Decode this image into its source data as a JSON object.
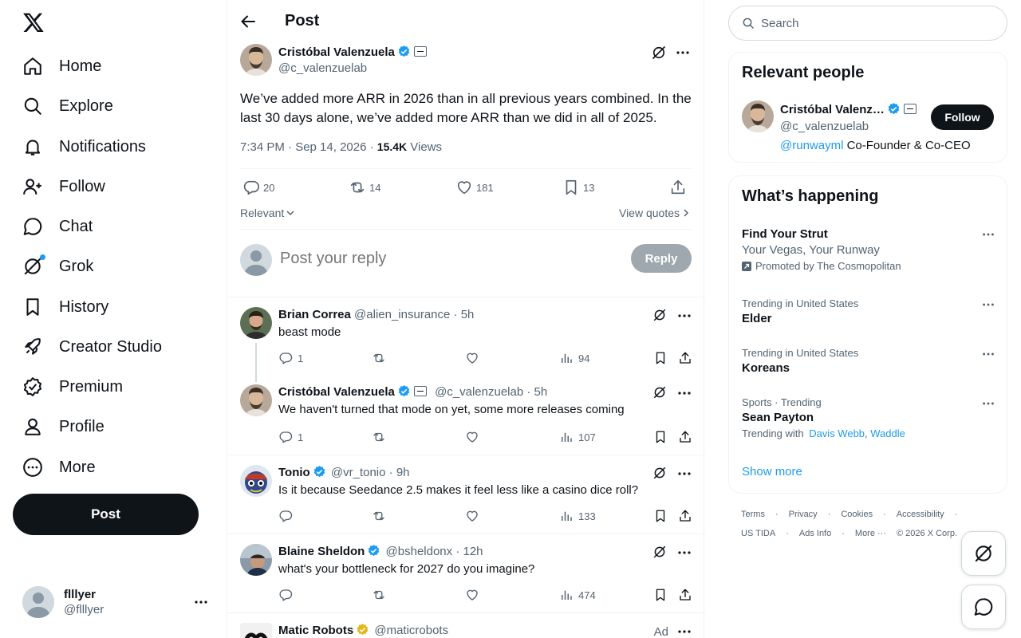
{
  "nav": {
    "items": [
      {
        "label": "Home",
        "icon": "home-icon"
      },
      {
        "label": "Explore",
        "icon": "search-icon"
      },
      {
        "label": "Notifications",
        "icon": "bell-icon"
      },
      {
        "label": "Follow",
        "icon": "person-plus-icon"
      },
      {
        "label": "Chat",
        "icon": "chat-bubble-icon"
      },
      {
        "label": "Grok",
        "icon": "grok-icon"
      },
      {
        "label": "History",
        "icon": "bookmark-icon"
      },
      {
        "label": "Creator Studio",
        "icon": "rocket-icon"
      },
      {
        "label": "Premium",
        "icon": "verified-badge-icon"
      },
      {
        "label": "Profile",
        "icon": "person-icon"
      },
      {
        "label": "More",
        "icon": "more-circle-icon"
      }
    ],
    "post_button": "Post",
    "account": {
      "name": "flllyer",
      "handle": "@flllyer"
    }
  },
  "header": {
    "title": "Post"
  },
  "post": {
    "author": "Cristóbal Valenzuela",
    "handle": "@c_valenzuelab",
    "text": "We’ve added more ARR in 2026 than in all previous years combined. In the last 30 days alone, we’ve added more ARR than we did in all of 2025.",
    "timestamp": "7:34 PM · Sep 14, 2026 · ",
    "views_count": "15.4K",
    "views_label": " Views",
    "replies": "20",
    "reposts": "14",
    "likes": "181",
    "bookmarks": "13",
    "sort_label": "Relevant",
    "view_quotes": "View quotes"
  },
  "reply_box": {
    "placeholder": "Post your reply",
    "button": "Reply"
  },
  "replies": [
    {
      "name": "Brian Correa",
      "handle": "@alien_insurance",
      "time": "· 5h",
      "text": "beast mode",
      "reply_count": "1",
      "views": "94",
      "verified": false
    },
    {
      "name": "Cristóbal Valenzuela",
      "handle": "@c_valenzuelab",
      "time": "· 5h",
      "text": "We haven't turned that mode on yet, some more releases coming",
      "reply_count": "1",
      "views": "107",
      "verified": true
    },
    {
      "name": "Tonio",
      "handle": "@vr_tonio",
      "time": "· 9h",
      "text": "Is it because Seedance 2.5 makes it feel less like a casino dice roll?",
      "reply_count": "",
      "views": "133",
      "verified": true
    },
    {
      "name": "Blaine Sheldon",
      "handle": "@bsheldonx",
      "time": "· 12h",
      "text": "what's your bottleneck for 2027 do you imagine?",
      "reply_count": "",
      "views": "474",
      "verified": true
    },
    {
      "name": "Matic Robots",
      "handle": "@maticrobots",
      "ad": "Ad"
    }
  ],
  "search": {
    "placeholder": "Search"
  },
  "relevant_people": {
    "title": "Relevant people",
    "name": "Cristóbal Valenz…",
    "handle": "@c_valenzuelab",
    "bio_link": "@runwayml",
    "bio_rest": " Co-Founder & Co-CEO",
    "follow": "Follow"
  },
  "happening": {
    "title": "What’s happening",
    "promo": {
      "title": "Find Your Strut",
      "subtitle": "Your Vegas, Your Runway",
      "promoted": "Promoted by The Cosmopolitan"
    },
    "trends": [
      {
        "category": "Trending in United States",
        "title": "Elder"
      },
      {
        "category": "Trending in United States",
        "title": "Koreans"
      },
      {
        "category": "Sports · Trending",
        "title": "Sean Payton",
        "with_label": "Trending with",
        "with_1": "Davis Webb",
        "with_2": "Waddle"
      }
    ],
    "show_more": "Show more"
  },
  "footer": {
    "links": [
      "Terms",
      "·",
      "Privacy",
      "·",
      "Cookies",
      "·",
      "Accessibility",
      "·",
      "US TIDA",
      "·",
      "Ads Info",
      "·",
      "More ···",
      "© 2026 X Corp."
    ]
  },
  "colors": {
    "accent": "#1d9bf0",
    "gold": "#e2b719",
    "text": "#0f1419",
    "muted": "#536471"
  }
}
